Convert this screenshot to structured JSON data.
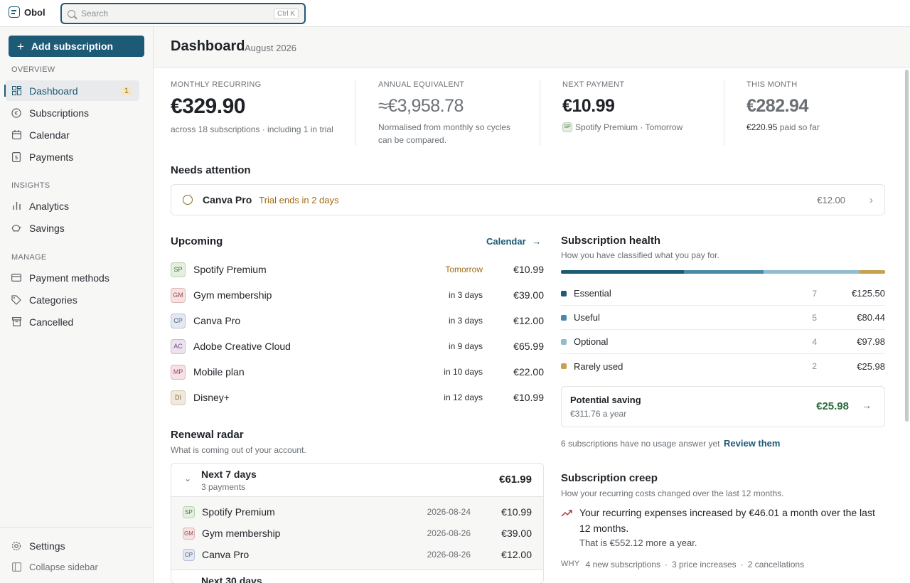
{
  "app": {
    "name": "Obol"
  },
  "search": {
    "placeholder": "Search",
    "shortcut": "Ctrl K"
  },
  "sidebar": {
    "add_label": "Add subscription",
    "sections": {
      "overview": "OVERVIEW",
      "insights": "INSIGHTS",
      "manage": "MANAGE"
    },
    "items": {
      "dashboard": "Dashboard",
      "dashboard_badge": "1",
      "subscriptions": "Subscriptions",
      "calendar": "Calendar",
      "payments": "Payments",
      "analytics": "Analytics",
      "savings": "Savings",
      "payment_methods": "Payment methods",
      "categories": "Categories",
      "cancelled": "Cancelled"
    },
    "settings": "Settings",
    "collapse": "Collapse sidebar"
  },
  "header": {
    "title": "Dashboard",
    "date": "August 2026"
  },
  "kpis": [
    {
      "label": "MONTHLY RECURRING",
      "value": "€329.90",
      "sub": "across 18 subscriptions · including 1 in trial"
    },
    {
      "label": "ANNUAL EQUIVALENT",
      "value": "≈€3,958.78",
      "sub": "Normalised from monthly so cycles can be compared."
    },
    {
      "label": "NEXT PAYMENT",
      "value": "€10.99",
      "avatar": "SP",
      "sub": "Spotify Premium · Tomorrow"
    },
    {
      "label": "THIS MONTH",
      "value": "€282.94",
      "sub_amount": "€220.95",
      "sub": "paid so far"
    }
  ],
  "attention": {
    "title": "Needs attention",
    "item": {
      "name": "Canva Pro",
      "note": "Trial ends in 2 days",
      "amount": "€12.00"
    }
  },
  "upcoming": {
    "title": "Upcoming",
    "link": "Calendar",
    "items": [
      {
        "avatar": "SP",
        "name": "Spotify Premium",
        "when": "Tomorrow",
        "amount": "€10.99"
      },
      {
        "avatar": "GM",
        "name": "Gym membership",
        "when": "in 3 days",
        "amount": "€39.00"
      },
      {
        "avatar": "CP",
        "name": "Canva Pro",
        "when": "in 3 days",
        "amount": "€12.00"
      },
      {
        "avatar": "AC",
        "name": "Adobe Creative Cloud",
        "when": "in 9 days",
        "amount": "€65.99"
      },
      {
        "avatar": "MP",
        "name": "Mobile plan",
        "when": "in 10 days",
        "amount": "€22.00"
      },
      {
        "avatar": "DI",
        "name": "Disney+",
        "when": "in 12 days",
        "amount": "€10.99"
      }
    ]
  },
  "radar": {
    "title": "Renewal radar",
    "subtitle": "What is coming out of your account.",
    "group1": {
      "label": "Next 7 days",
      "count": "3 payments",
      "total": "€61.99"
    },
    "items": [
      {
        "avatar": "SP",
        "name": "Spotify Premium",
        "date": "2026-08-24",
        "amount": "€10.99"
      },
      {
        "avatar": "GM",
        "name": "Gym membership",
        "date": "2026-08-26",
        "amount": "€39.00"
      },
      {
        "avatar": "CP",
        "name": "Canva Pro",
        "date": "2026-08-26",
        "amount": "€12.00"
      }
    ],
    "group2": {
      "label": "Next 30 days"
    }
  },
  "health": {
    "title": "Subscription health",
    "subtitle": "How you have classified what you pay for.",
    "rows": [
      {
        "name": "Essential",
        "count": "7",
        "amount": "€125.50",
        "share": 0.38,
        "color": "#1d5a76"
      },
      {
        "name": "Useful",
        "count": "5",
        "amount": "€80.44",
        "share": 0.245,
        "color": "#4a8aa8"
      },
      {
        "name": "Optional",
        "count": "4",
        "amount": "€97.98",
        "share": 0.297,
        "color": "#93bccd"
      },
      {
        "name": "Rarely used",
        "count": "2",
        "amount": "€25.98",
        "share": 0.078,
        "color": "#c7a14e"
      }
    ],
    "saving": {
      "title": "Potential saving",
      "annual": "€311.76",
      "annual_suffix": "a year",
      "amount": "€25.98"
    },
    "review_note": "6 subscriptions have no usage answer yet",
    "review_link": "Review them"
  },
  "creep": {
    "title": "Subscription creep",
    "subtitle": "How your recurring costs changed over the last 12 months.",
    "headline": "Your recurring expenses increased by €46.01 a month over the last 12 months.",
    "yearly": "That is €552.12 more a year.",
    "why_label": "WHY",
    "why_items": [
      "4 new subscriptions",
      "3 price increases",
      "2 cancellations"
    ]
  }
}
